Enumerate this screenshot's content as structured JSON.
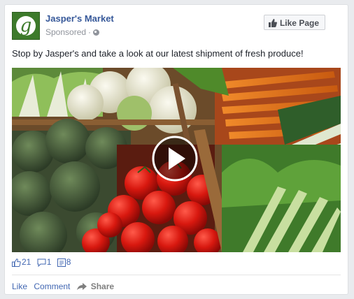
{
  "post": {
    "page_name": "Jasper's Market",
    "sponsored_label": "Sponsored",
    "separator": "·",
    "logo_letter": "g",
    "like_page_label": "Like Page",
    "message": "Stop by Jasper's and take a look at our latest shipment of fresh produce!",
    "media": {
      "type": "video",
      "play_icon": "play-icon",
      "content": "vegetables-stand-photo"
    },
    "stats": {
      "likes": "21",
      "comments": "1",
      "shares": "8"
    },
    "actions": {
      "like_label": "Like",
      "comment_label": "Comment",
      "share_label": "Share"
    }
  },
  "colors": {
    "link_blue": "#365899",
    "action_blue": "#4267b2",
    "muted_gray": "#90949c",
    "brand_green": "#3d7a2b"
  }
}
